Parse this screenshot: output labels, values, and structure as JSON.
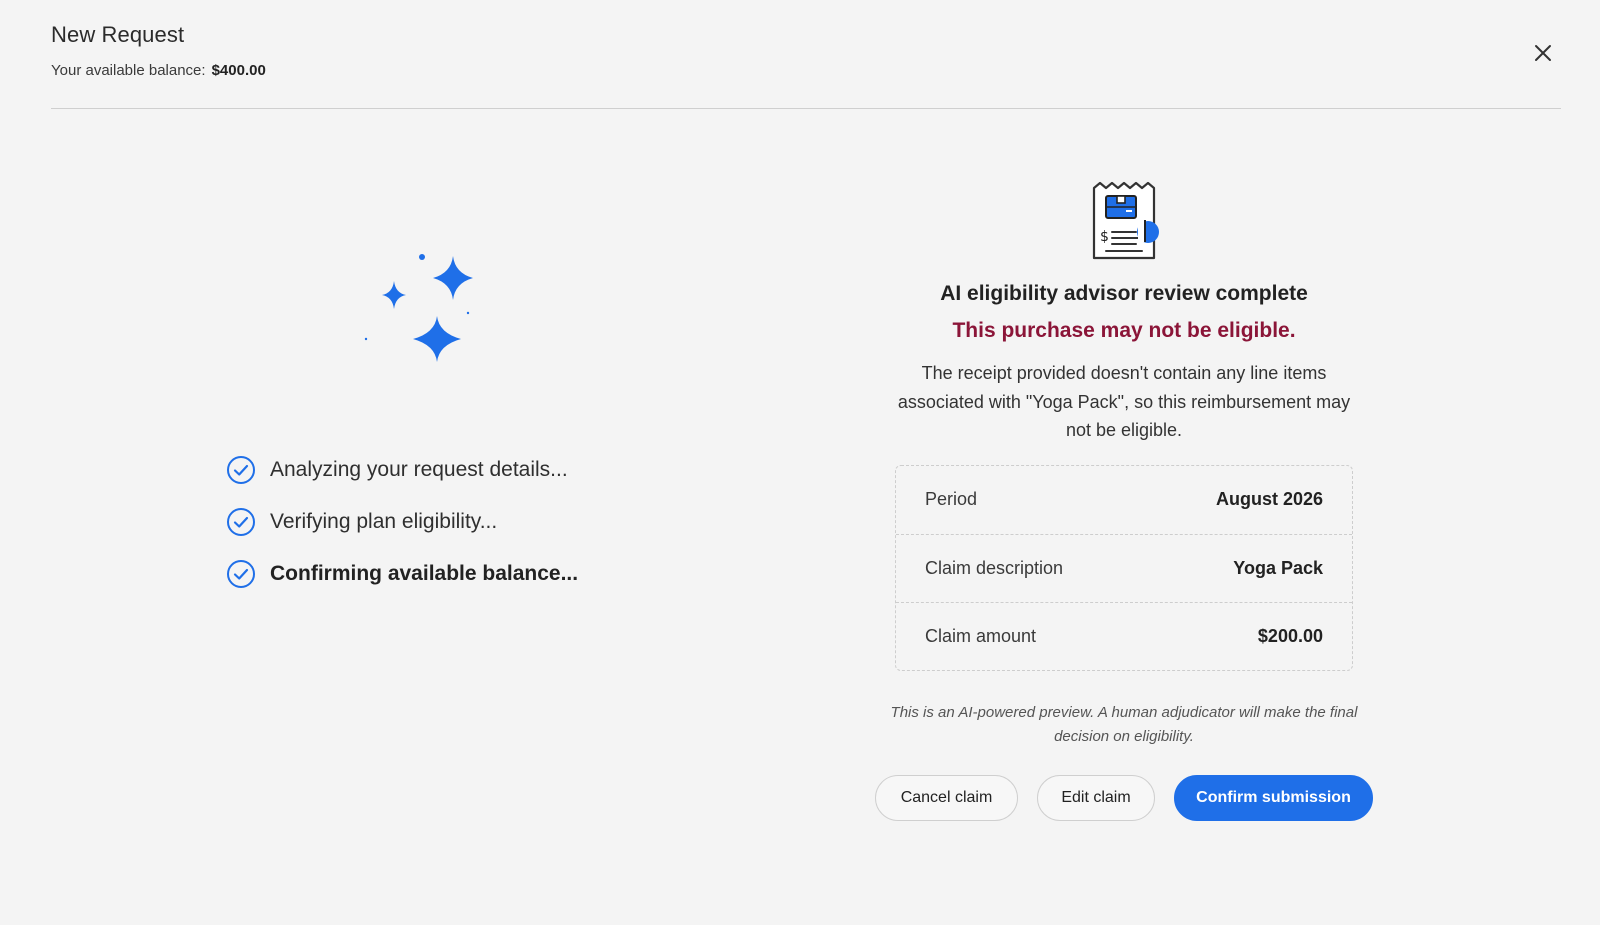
{
  "header": {
    "title": "New Request",
    "balance_label": "Your available balance:",
    "balance_value": "$400.00",
    "close_icon": "close-icon"
  },
  "progress": {
    "icon": "sparkles-icon",
    "steps": [
      {
        "label": "Analyzing your request details...",
        "done": true,
        "emphasis": false
      },
      {
        "label": "Verifying plan eligibility...",
        "done": true,
        "emphasis": false
      },
      {
        "label": "Confirming available balance...",
        "done": true,
        "emphasis": true
      }
    ]
  },
  "review": {
    "icon": "receipt-icon",
    "title": "AI eligibility advisor review complete",
    "warning": "This purchase may not be eligible.",
    "description": "The receipt provided doesn't contain any line items associated with \"Yoga Pack\", so this reimbursement may not be eligible.",
    "details": [
      {
        "key": "Period",
        "value": "August 2026"
      },
      {
        "key": "Claim description",
        "value": "Yoga Pack"
      },
      {
        "key": "Claim amount",
        "value": "$200.00"
      }
    ],
    "disclaimer": "This is an AI-powered preview. A human adjudicator will make the final decision on eligibility."
  },
  "actions": {
    "cancel_label": "Cancel claim",
    "edit_label": "Edit claim",
    "confirm_label": "Confirm submission"
  },
  "colors": {
    "accent": "#1f6fe8",
    "warning": "#8b1538",
    "background": "#f4f4f4"
  }
}
